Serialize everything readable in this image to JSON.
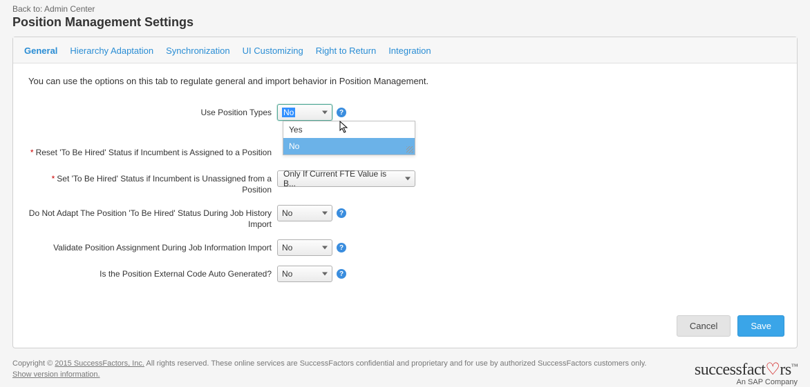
{
  "header": {
    "back_label": "Back to: Admin Center",
    "title": "Position Management Settings"
  },
  "tabs": [
    {
      "label": "General",
      "active": true
    },
    {
      "label": "Hierarchy Adaptation",
      "active": false
    },
    {
      "label": "Synchronization",
      "active": false
    },
    {
      "label": "UI Customizing",
      "active": false
    },
    {
      "label": "Right to Return",
      "active": false
    },
    {
      "label": "Integration",
      "active": false
    }
  ],
  "intro": "You can use the options on this tab to regulate general and import behavior in Position Management.",
  "fields": {
    "use_position_types": {
      "label": "Use Position Types",
      "required": false,
      "value": "No",
      "options": [
        "Yes",
        "No"
      ],
      "selected_option_index": 1,
      "help": true,
      "open": true
    },
    "reset_tbh": {
      "label": "Reset 'To Be Hired' Status if Incumbent is Assigned to a Position",
      "required": true,
      "value": ""
    },
    "set_tbh": {
      "label": "Set 'To Be Hired' Status if Incumbent is Unassigned from a Position",
      "required": true,
      "value": "Only If Current FTE Value is B..."
    },
    "do_not_adapt": {
      "label": "Do Not Adapt The Position 'To Be Hired' Status During Job History Import",
      "required": false,
      "value": "No",
      "help": true
    },
    "validate_assign": {
      "label": "Validate Position Assignment During Job Information Import",
      "required": false,
      "value": "No",
      "help": true
    },
    "auto_generated": {
      "label": "Is the Position External Code Auto Generated?",
      "required": false,
      "value": "No",
      "help": true
    }
  },
  "buttons": {
    "cancel": "Cancel",
    "save": "Save"
  },
  "footer": {
    "copyright_prefix": "Copyright © ",
    "copyright_link": "2015 SuccessFactors, Inc.",
    "copyright_suffix": " All rights reserved. These online services are SuccessFactors confidential and proprietary and for use by authorized SuccessFactors customers only.",
    "show_version": "Show version information.",
    "brand_main": "successfactors",
    "brand_tm": "™",
    "brand_sub": "An SAP Company"
  }
}
